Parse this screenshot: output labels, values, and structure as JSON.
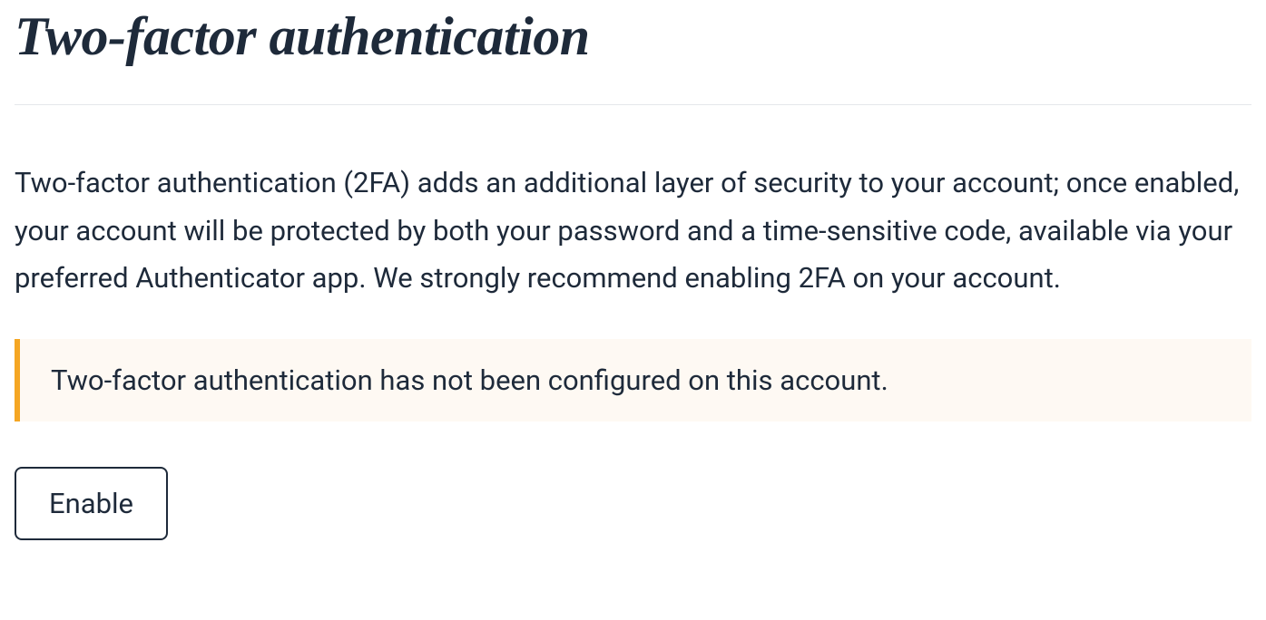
{
  "page": {
    "title": "Two-factor authentication",
    "description": "Two-factor authentication (2FA) adds an additional layer of security to your account; once enabled, your account will be protected by both your password and a time-sensitive code, available via your preferred Authenticator app. We strongly recommend enabling 2FA on your account."
  },
  "alert": {
    "message": "Two-factor authentication has not been configured on this account."
  },
  "actions": {
    "enable_label": "Enable"
  },
  "colors": {
    "text_primary": "#1e2a3a",
    "alert_bg": "#fef9f3",
    "alert_border": "#f5a623",
    "divider": "#e5e7eb"
  }
}
